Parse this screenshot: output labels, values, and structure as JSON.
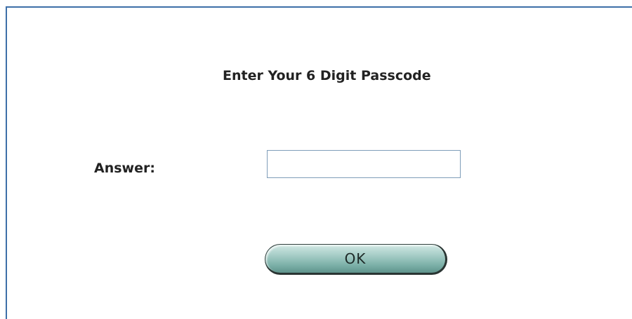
{
  "form": {
    "heading": "Enter Your 6 Digit Passcode",
    "answer_label": "Answer:",
    "answer_value": "",
    "ok_label": "OK"
  },
  "colors": {
    "frame_border": "#3d6fa8",
    "button_fill": "#7fb3ab",
    "text": "#222222"
  }
}
